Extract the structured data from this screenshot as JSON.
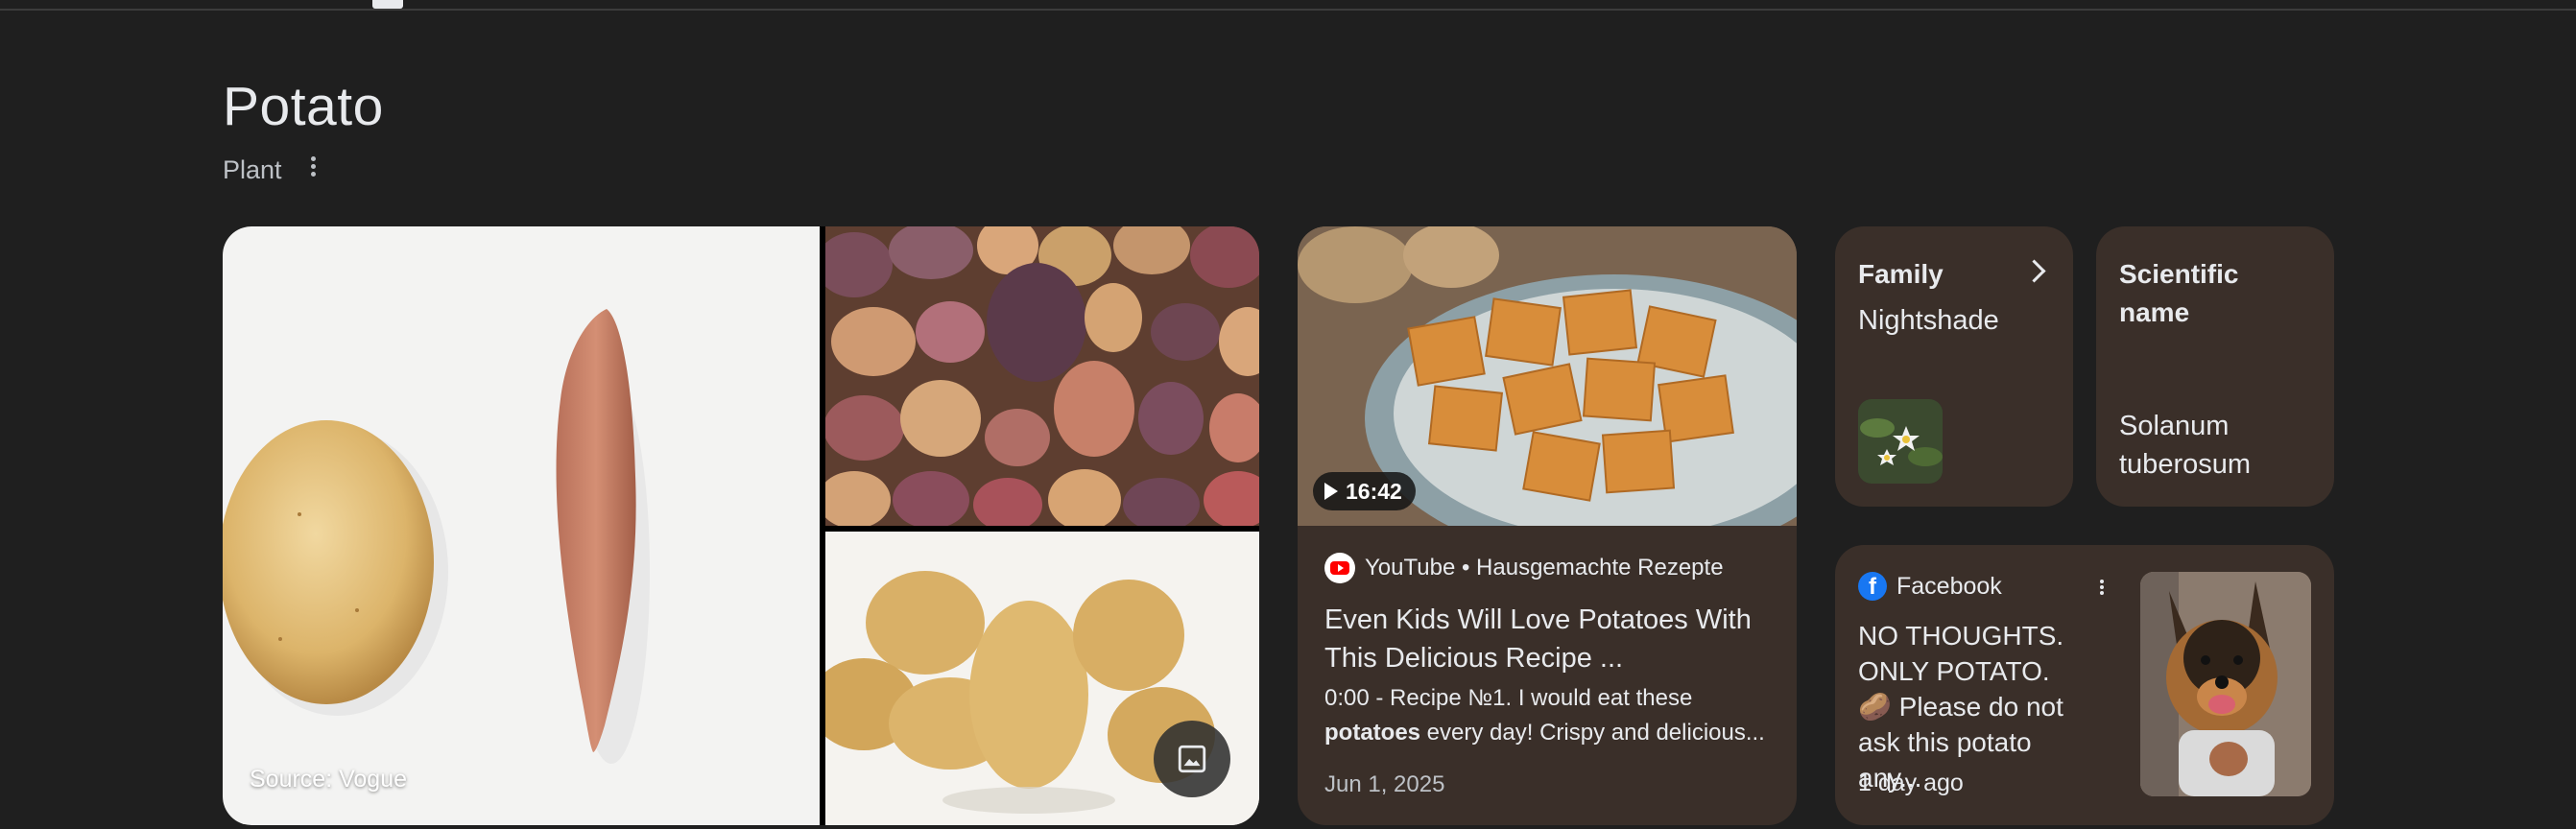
{
  "header": {
    "title": "Potato",
    "subtitle": "Plant"
  },
  "images": {
    "source_caption": "Source: Vogue",
    "more_images_icon": "image-icon"
  },
  "video": {
    "duration": "16:42",
    "source": "YouTube • Hausgemachte Rezepte",
    "title": "Even Kids Will Love Potatoes With This Delicious Recipe ...",
    "snippet_prefix": "0:00 - Recipe №1. I would eat these ",
    "snippet_bold": "potatoes",
    "snippet_suffix": " every day! Crispy and delicious...",
    "date": "Jun 1, 2025",
    "source_icon": "youtube-icon"
  },
  "facts": {
    "family_label": "Family",
    "family_value": "Nightshade",
    "scientific_label": "Scientific name",
    "scientific_value": "Solanum tuberosum"
  },
  "facebook": {
    "source": "Facebook",
    "text": "NO THOUGHTS. ONLY POTATO. 🥔 Please do not ask this potato any...",
    "time": "1 day ago",
    "source_icon": "facebook-icon"
  },
  "colors": {
    "background": "#1f1f1f",
    "card": "#3a2f29",
    "text": "#e8eaed",
    "muted": "#bdc1c6"
  }
}
